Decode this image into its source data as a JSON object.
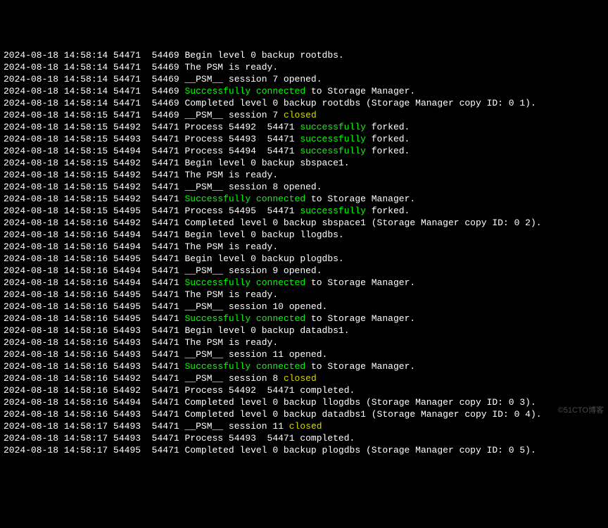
{
  "watermark": "©51CTO博客",
  "lines": [
    {
      "ts": "2024-08-18 14:58:14",
      "p1": "54471",
      "p2": "54469",
      "segs": [
        {
          "t": "Begin level 0 backup rootdbs."
        }
      ]
    },
    {
      "ts": "2024-08-18 14:58:14",
      "p1": "54471",
      "p2": "54469",
      "segs": [
        {
          "t": "The PSM is ready."
        }
      ]
    },
    {
      "ts": "2024-08-18 14:58:14",
      "p1": "54471",
      "p2": "54469",
      "segs": [
        {
          "t": "__PSM__ session 7 opened."
        }
      ]
    },
    {
      "ts": "2024-08-18 14:58:14",
      "p1": "54471",
      "p2": "54469",
      "segs": [
        {
          "t": "Successfully connected",
          "c": "g"
        },
        {
          "t": " to Storage Manager."
        }
      ]
    },
    {
      "ts": "2024-08-18 14:58:14",
      "p1": "54471",
      "p2": "54469",
      "segs": [
        {
          "t": "Completed level 0 backup rootdbs (Storage Manager copy ID: 0 1)."
        }
      ]
    },
    {
      "ts": "2024-08-18 14:58:15",
      "p1": "54471",
      "p2": "54469",
      "segs": [
        {
          "t": "__PSM__ session 7 "
        },
        {
          "t": "closed",
          "c": "y"
        }
      ]
    },
    {
      "ts": "2024-08-18 14:58:15",
      "p1": "54492",
      "p2": "54471",
      "segs": [
        {
          "t": "Process 54492  54471 "
        },
        {
          "t": "successfully",
          "c": "g"
        },
        {
          "t": " forked."
        }
      ]
    },
    {
      "ts": "2024-08-18 14:58:15",
      "p1": "54493",
      "p2": "54471",
      "segs": [
        {
          "t": "Process 54493  54471 "
        },
        {
          "t": "successfully",
          "c": "g"
        },
        {
          "t": " forked."
        }
      ]
    },
    {
      "ts": "2024-08-18 14:58:15",
      "p1": "54494",
      "p2": "54471",
      "segs": [
        {
          "t": "Process 54494  54471 "
        },
        {
          "t": "successfully",
          "c": "g"
        },
        {
          "t": " forked."
        }
      ]
    },
    {
      "ts": "2024-08-18 14:58:15",
      "p1": "54492",
      "p2": "54471",
      "segs": [
        {
          "t": "Begin level 0 backup sbspace1."
        }
      ]
    },
    {
      "ts": "2024-08-18 14:58:15",
      "p1": "54492",
      "p2": "54471",
      "segs": [
        {
          "t": "The PSM is ready."
        }
      ]
    },
    {
      "ts": "2024-08-18 14:58:15",
      "p1": "54492",
      "p2": "54471",
      "segs": [
        {
          "t": "__PSM__ session 8 opened."
        }
      ]
    },
    {
      "ts": "2024-08-18 14:58:15",
      "p1": "54492",
      "p2": "54471",
      "segs": [
        {
          "t": "Successfully connected",
          "c": "g"
        },
        {
          "t": " to Storage Manager."
        }
      ]
    },
    {
      "ts": "2024-08-18 14:58:15",
      "p1": "54495",
      "p2": "54471",
      "segs": [
        {
          "t": "Process 54495  54471 "
        },
        {
          "t": "successfully",
          "c": "g"
        },
        {
          "t": " forked."
        }
      ]
    },
    {
      "ts": "2024-08-18 14:58:16",
      "p1": "54492",
      "p2": "54471",
      "segs": [
        {
          "t": "Completed level 0 backup sbspace1 (Storage Manager copy ID: 0 2)."
        }
      ]
    },
    {
      "ts": "2024-08-18 14:58:16",
      "p1": "54494",
      "p2": "54471",
      "segs": [
        {
          "t": "Begin level 0 backup llogdbs."
        }
      ]
    },
    {
      "ts": "2024-08-18 14:58:16",
      "p1": "54494",
      "p2": "54471",
      "segs": [
        {
          "t": "The PSM is ready."
        }
      ]
    },
    {
      "ts": "2024-08-18 14:58:16",
      "p1": "54495",
      "p2": "54471",
      "segs": [
        {
          "t": "Begin level 0 backup plogdbs."
        }
      ]
    },
    {
      "ts": "2024-08-18 14:58:16",
      "p1": "54494",
      "p2": "54471",
      "segs": [
        {
          "t": "__PSM__ session 9 opened."
        }
      ]
    },
    {
      "ts": "2024-08-18 14:58:16",
      "p1": "54494",
      "p2": "54471",
      "segs": [
        {
          "t": "Successfully connected",
          "c": "g"
        },
        {
          "t": " to Storage Manager."
        }
      ]
    },
    {
      "ts": "2024-08-18 14:58:16",
      "p1": "54495",
      "p2": "54471",
      "segs": [
        {
          "t": "The PSM is ready."
        }
      ]
    },
    {
      "ts": "2024-08-18 14:58:16",
      "p1": "54495",
      "p2": "54471",
      "segs": [
        {
          "t": "__PSM__ session 10 opened."
        }
      ]
    },
    {
      "ts": "2024-08-18 14:58:16",
      "p1": "54495",
      "p2": "54471",
      "segs": [
        {
          "t": "Successfully connected",
          "c": "g"
        },
        {
          "t": " to Storage Manager."
        }
      ]
    },
    {
      "ts": "2024-08-18 14:58:16",
      "p1": "54493",
      "p2": "54471",
      "segs": [
        {
          "t": "Begin level 0 backup datadbs1."
        }
      ]
    },
    {
      "ts": "2024-08-18 14:58:16",
      "p1": "54493",
      "p2": "54471",
      "segs": [
        {
          "t": "The PSM is ready."
        }
      ]
    },
    {
      "ts": "2024-08-18 14:58:16",
      "p1": "54493",
      "p2": "54471",
      "segs": [
        {
          "t": "__PSM__ session 11 opened."
        }
      ]
    },
    {
      "ts": "2024-08-18 14:58:16",
      "p1": "54493",
      "p2": "54471",
      "segs": [
        {
          "t": "Successfully connected",
          "c": "g"
        },
        {
          "t": " to Storage Manager."
        }
      ]
    },
    {
      "ts": "2024-08-18 14:58:16",
      "p1": "54492",
      "p2": "54471",
      "segs": [
        {
          "t": "__PSM__ session 8 "
        },
        {
          "t": "closed",
          "c": "y"
        }
      ]
    },
    {
      "ts": "2024-08-18 14:58:16",
      "p1": "54492",
      "p2": "54471",
      "segs": [
        {
          "t": "Process 54492  54471 completed."
        }
      ]
    },
    {
      "ts": "2024-08-18 14:58:16",
      "p1": "54494",
      "p2": "54471",
      "segs": [
        {
          "t": "Completed level 0 backup llogdbs (Storage Manager copy ID: 0 3)."
        }
      ]
    },
    {
      "ts": "2024-08-18 14:58:16",
      "p1": "54493",
      "p2": "54471",
      "segs": [
        {
          "t": "Completed level 0 backup datadbs1 (Storage Manager copy ID: 0 4)."
        }
      ]
    },
    {
      "ts": "2024-08-18 14:58:17",
      "p1": "54493",
      "p2": "54471",
      "segs": [
        {
          "t": "__PSM__ session 11 "
        },
        {
          "t": "closed",
          "c": "y"
        }
      ]
    },
    {
      "ts": "2024-08-18 14:58:17",
      "p1": "54493",
      "p2": "54471",
      "segs": [
        {
          "t": "Process 54493  54471 completed."
        }
      ]
    },
    {
      "ts": "2024-08-18 14:58:17",
      "p1": "54495",
      "p2": "54471",
      "segs": [
        {
          "t": "Completed level 0 backup plogdbs (Storage Manager copy ID: 0 5)."
        }
      ]
    }
  ]
}
